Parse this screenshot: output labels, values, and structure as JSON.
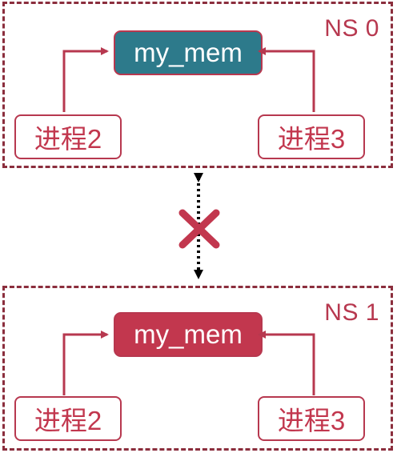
{
  "namespaces": [
    {
      "label": "NS 0",
      "shared_memory": "my_mem",
      "processes": [
        "进程2",
        "进程3"
      ]
    },
    {
      "label": "NS 1",
      "shared_memory": "my_mem",
      "processes": [
        "进程2",
        "进程3"
      ]
    }
  ],
  "colors": {
    "frame": "#8b2e3d",
    "accent_red": "#c2374e",
    "teal": "#2d7a8b",
    "cross": "#c2374e"
  },
  "icons": {
    "blocked_marker": "x-cross-icon"
  }
}
